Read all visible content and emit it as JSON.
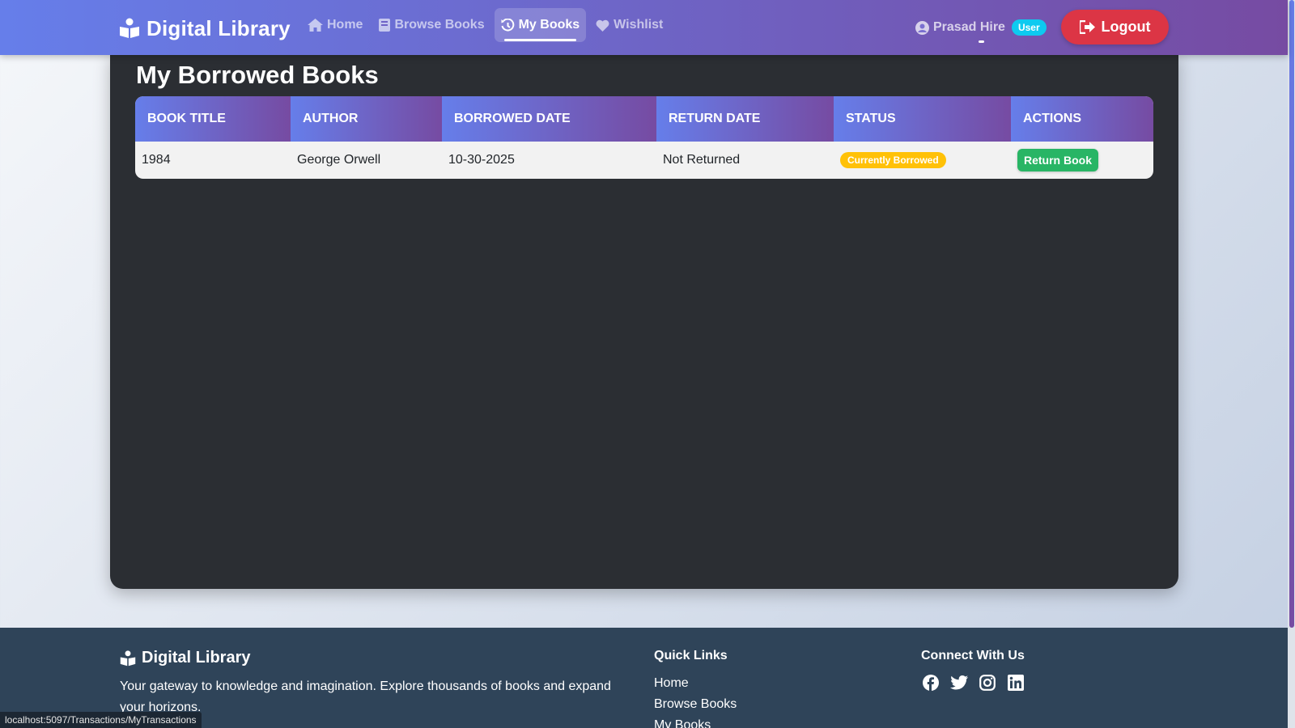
{
  "navbar": {
    "brand": "Digital Library",
    "links": [
      {
        "label": "Home",
        "icon": "home-icon",
        "active": false
      },
      {
        "label": "Browse Books",
        "icon": "book-icon",
        "active": false
      },
      {
        "label": "My Books",
        "icon": "history-icon",
        "active": true
      },
      {
        "label": "Wishlist",
        "icon": "heart-icon",
        "active": false
      }
    ],
    "user_name": "Prasad Hire",
    "user_role": "User",
    "logout_label": "Logout"
  },
  "main": {
    "title": "My Borrowed Books",
    "columns": [
      "Book Title",
      "Author",
      "Borrowed Date",
      "Return Date",
      "Status",
      "Actions"
    ],
    "rows": [
      {
        "title": "1984",
        "author": "George Orwell",
        "borrowed_date": "10-30-2025",
        "return_date": "Not Returned",
        "status": "Currently Borrowed",
        "action": "Return Book"
      }
    ]
  },
  "footer": {
    "brand": "Digital Library",
    "tagline": "Your gateway to knowledge and imagination. Explore thousands of books and expand your horizons.",
    "quick_links_title": "Quick Links",
    "quick_links": [
      "Home",
      "Browse Books",
      "My Books"
    ],
    "connect_title": "Connect With Us",
    "social": [
      "facebook-icon",
      "twitter-icon",
      "instagram-icon",
      "linkedin-icon"
    ]
  },
  "status_bar_url": "localhost:5097/Transactions/MyTransactions",
  "colors": {
    "nav_gradient_start": "#667eea",
    "nav_gradient_end": "#764ba2",
    "logout": "#dc3545",
    "status_badge": "#ffc107",
    "return_button": "#28b565",
    "role_badge": "#0dcaf0",
    "footer_bg": "#2f4459"
  }
}
